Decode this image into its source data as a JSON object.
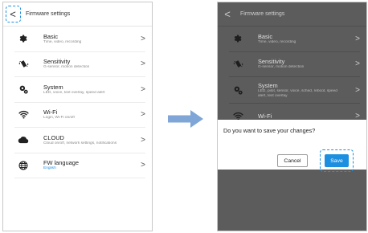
{
  "left": {
    "topbar": {
      "back_label": "<",
      "title": "Firmware settings"
    },
    "items": [
      {
        "icon": "gear-icon",
        "title": "Basic",
        "subtitle": "Time, video, recording",
        "accent": false
      },
      {
        "icon": "vibration-icon",
        "title": "Sensitivity",
        "subtitle": "G-sensor, motion detection",
        "accent": false
      },
      {
        "icon": "gears-icon",
        "title": "System",
        "subtitle": "LED, voice, text overlay, speed alert",
        "accent": false
      },
      {
        "icon": "wifi-icon",
        "title": "Wi-Fi",
        "subtitle": "Login, Wi-Fi on/off",
        "accent": false
      },
      {
        "icon": "cloud-icon",
        "title": "CLOUD",
        "subtitle": "Cloud on/off, network settings, notifications",
        "accent": false
      },
      {
        "icon": "globe-icon",
        "title": "FW language",
        "subtitle": "English",
        "accent": true
      }
    ],
    "chevron": ">"
  },
  "right": {
    "topbar": {
      "back_label": "<",
      "title": "Firmware settings"
    },
    "items": [
      {
        "title": "Basic",
        "subtitle": "Time, video, recording"
      },
      {
        "title": "Sensitivity",
        "subtitle": "G-sensor, motion detection"
      },
      {
        "title": "System",
        "subtitle": "LED, pilot, sensor, voice, sched, reboot, speed",
        "subtitle2": "alert, text overlay"
      },
      {
        "title": "Wi-Fi",
        "subtitle": ""
      }
    ],
    "chevron": ">",
    "dialog": {
      "message": "Do you want to save your changes?",
      "cancel_label": "Cancel",
      "save_label": "Save"
    }
  },
  "colors": {
    "accent": "#1d8fe0",
    "arrow": "#7fa6d6",
    "overlay": "#5c5c5c"
  }
}
